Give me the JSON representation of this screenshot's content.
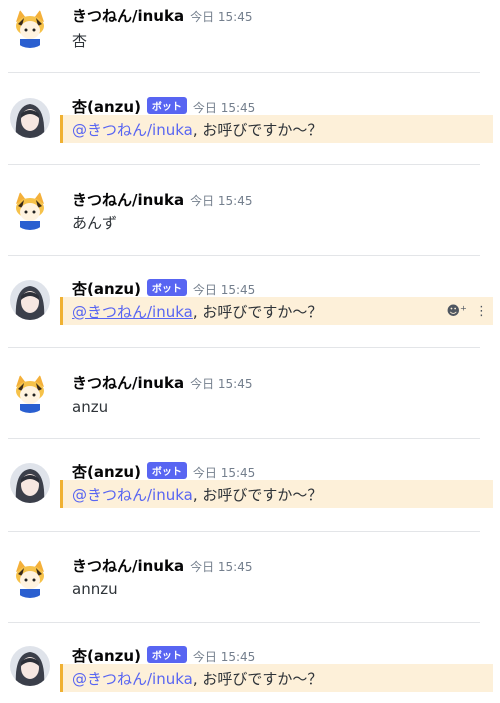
{
  "bot_badge": "ボット",
  "messages": [
    {
      "author": "きつねん/inuka",
      "time": "今日 15:45",
      "text": "杏"
    },
    {
      "author": "杏(anzu)",
      "time": "今日 15:45",
      "mention": "@きつねん/inuka",
      "text": ", お呼びですか～？"
    },
    {
      "author": "きつねん/inuka",
      "time": "今日 15:45",
      "text": "あんず"
    },
    {
      "author": "杏(anzu)",
      "time": "今日 15:45",
      "mention": "@きつねん/inuka",
      "text": ", お呼びですか～？"
    },
    {
      "author": "きつねん/inuka",
      "time": "今日 15:45",
      "text": "anzu"
    },
    {
      "author": "杏(anzu)",
      "time": "今日 15:45",
      "mention": "@きつねん/inuka",
      "text": ", お呼びですか～？"
    },
    {
      "author": "きつねん/inuka",
      "time": "今日 15:45",
      "text": "annzu"
    },
    {
      "author": "杏(anzu)",
      "time": "今日 15:45",
      "mention": "@きつねん/inuka",
      "text": ", お呼びですか～？"
    }
  ],
  "hover_actions": {
    "reaction_icon": "add-reaction-icon",
    "more_icon": "more-options-icon"
  },
  "colors": {
    "accent": "#5865f2",
    "highlight_bg": "#fdf0d9",
    "highlight_border": "#f0b132"
  }
}
